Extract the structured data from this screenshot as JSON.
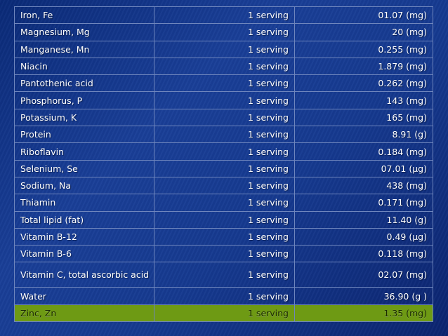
{
  "table": {
    "rows": [
      {
        "nutrient": "Iron, Fe",
        "serving": "1 serving",
        "amount": "01.07  (mg)"
      },
      {
        "nutrient": "Magnesium, Mg",
        "serving": "1 serving",
        "amount": "20  (mg)"
      },
      {
        "nutrient": "Manganese, Mn",
        "serving": "1 serving",
        "amount": "0.255  (mg)"
      },
      {
        "nutrient": "Niacin",
        "serving": "1 serving",
        "amount": "1.879  (mg)"
      },
      {
        "nutrient": "Pantothenic acid",
        "serving": "1 serving",
        "amount": "0.262  (mg)"
      },
      {
        "nutrient": "Phosphorus, P",
        "serving": "1 serving",
        "amount": "143  (mg)"
      },
      {
        "nutrient": "Potassium, K",
        "serving": "1 serving",
        "amount": "165  (mg)"
      },
      {
        "nutrient": "Protein",
        "serving": "1 serving",
        "amount": "8.91  (g)"
      },
      {
        "nutrient": "Riboflavin",
        "serving": "1 serving",
        "amount": "0.184  (mg)"
      },
      {
        "nutrient": "Selenium, Se",
        "serving": "1 serving",
        "amount": "07.01  (µg)"
      },
      {
        "nutrient": "Sodium, Na",
        "serving": "1 serving",
        "amount": "438  (mg)"
      },
      {
        "nutrient": "Thiamin",
        "serving": "1 serving",
        "amount": "0.171  (mg)"
      },
      {
        "nutrient": "Total lipid (fat)",
        "serving": "1 serving",
        "amount": "11.40  (g)"
      },
      {
        "nutrient": "Vitamin B-12",
        "serving": "1 serving",
        "amount": "0.49  (µg)"
      },
      {
        "nutrient": "Vitamin B-6",
        "serving": "1 serving",
        "amount": "0.118  (mg)"
      },
      {
        "nutrient": "Vitamin C, total ascorbic acid",
        "serving": "1 serving",
        "amount": "02.07  (mg)"
      },
      {
        "nutrient": "Water",
        "serving": "1 serving",
        "amount": "36.90  (g )"
      },
      {
        "nutrient": "Zinc, Zn",
        "serving": "1 serving",
        "amount": "1.35  (mg)"
      }
    ]
  },
  "colors": {
    "background": "#1a3f98",
    "highlight_row": "#6e9a14",
    "grid_line": "#6f86bd",
    "text": "#ffffff"
  }
}
